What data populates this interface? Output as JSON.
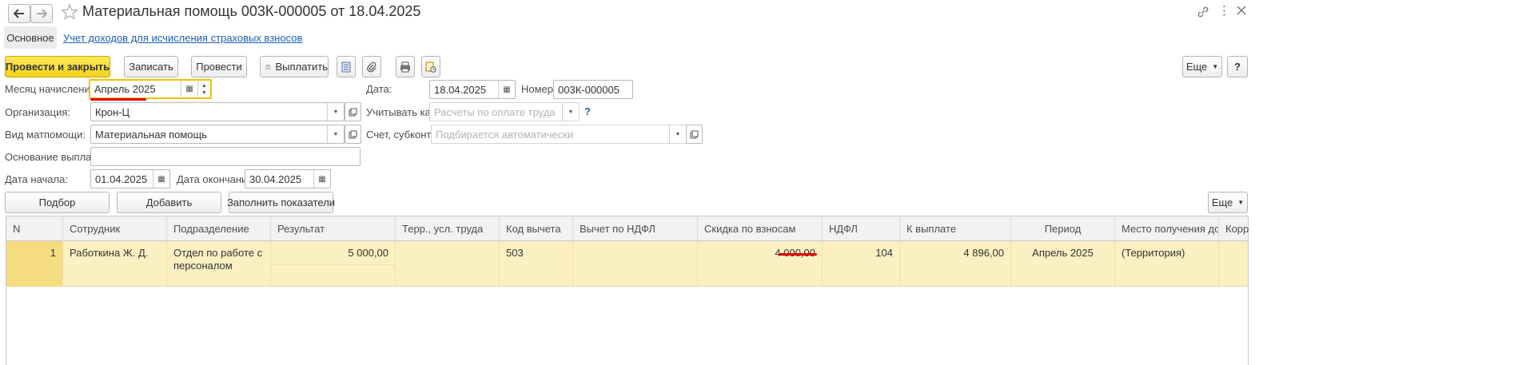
{
  "window": {
    "title": "Материальная помощь 003К-000005 от 18.04.2025"
  },
  "tabs": [
    {
      "label": "Основное"
    },
    {
      "label": "Учет доходов для исчисления страховых взносов"
    }
  ],
  "toolbar": {
    "post_close": "Провести и закрыть",
    "save": "Записать",
    "post": "Провести",
    "pay": "Выплатить",
    "more": "Еще",
    "help": "?"
  },
  "form": {
    "month_label": "Месяц начисления:",
    "month_value": "Апрель 2025",
    "date_label": "Дата:",
    "date_value": "18.04.2025",
    "number_label": "Номер:",
    "number_value": "003К-000005",
    "org_label": "Организация:",
    "org_value": "Крон-Ц",
    "account_as_label": "Учитывать как:",
    "account_as_placeholder": "Расчеты по оплате труда",
    "account_help": "?",
    "type_label": "Вид матпомощи:",
    "type_value": "Материальная помощь",
    "subconto_label": "Счет, субконто:",
    "subconto_placeholder": "Подбирается автоматически",
    "basis_label": "Основание выплаты:",
    "basis_value": "",
    "start_label": "Дата начала:",
    "start_value": "01.04.2025",
    "end_label": "Дата окончания:",
    "end_value": "30.04.2025"
  },
  "table_toolbar": {
    "select": "Подбор",
    "add": "Добавить",
    "fill": "Заполнить показатели",
    "more": "Еще"
  },
  "table": {
    "columns": [
      "N",
      "Сотрудник",
      "Подразделение",
      "Результат",
      "Терр., усл. труда",
      "Код вычета",
      "Вычет по НДФЛ",
      "Скидка по взносам",
      "НДФЛ",
      "К выплате",
      "Период",
      "Место получения до...",
      "Корре"
    ],
    "rows": [
      {
        "n": "1",
        "employee": "Работкина Ж. Д.",
        "department": "Отдел по работе с персоналом",
        "result": "5 000,00",
        "territory": "",
        "deduction_code": "503",
        "ndfl_deduction": "",
        "contrib_discount": "4 000,00",
        "ndfl": "104",
        "to_pay": "4 896,00",
        "period": "Апрель 2025",
        "place": "(Территория)",
        "corr": ""
      }
    ]
  },
  "colors": {
    "accent_yellow": "#f4d21c",
    "link_blue": "#1a5fb4",
    "row_highlight": "#fbf0c2",
    "annotation_red": "#e00000"
  }
}
